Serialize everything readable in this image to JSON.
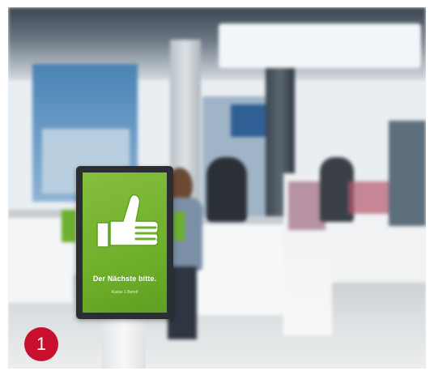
{
  "photo": {
    "kind": "blurred store interior with queue display kiosk"
  },
  "kiosk": {
    "screen_color": "#6fb02a",
    "icon": "thumbs-up-icon",
    "message": "Der Nächste bitte.",
    "subtext": "Kasse 1 Bereit"
  },
  "badge": {
    "number": "1",
    "color": "#c8102e"
  }
}
